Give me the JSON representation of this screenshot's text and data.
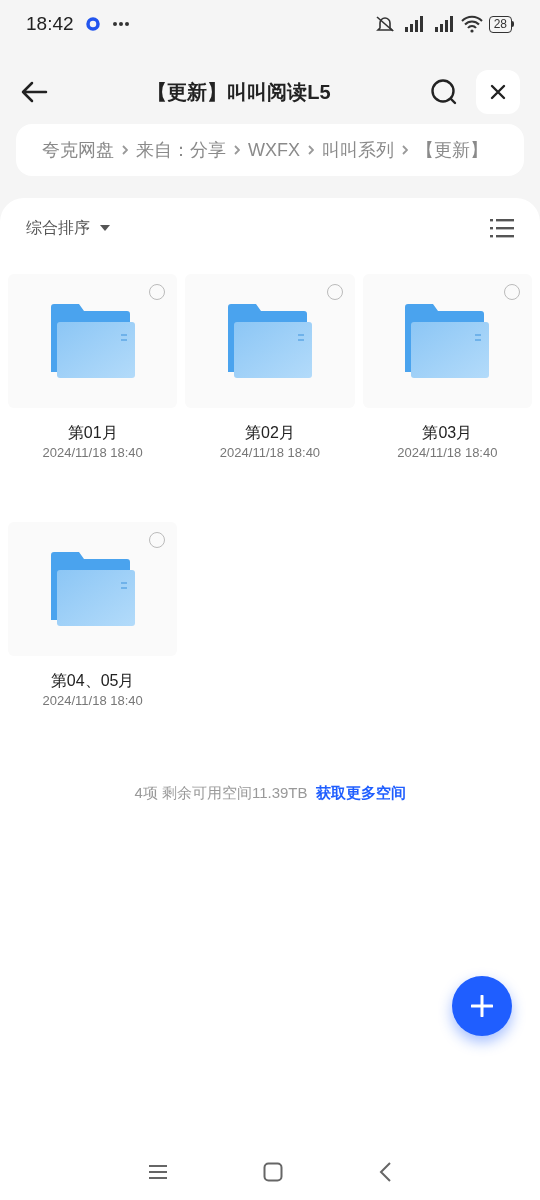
{
  "status_bar": {
    "time": "18:42",
    "battery": "28"
  },
  "header": {
    "title": "【更新】叫叫阅读L5"
  },
  "breadcrumb": [
    "夸克网盘",
    "来自：分享",
    "WXFX",
    "叫叫系列",
    "【更新】"
  ],
  "toolbar": {
    "sort": "综合排序"
  },
  "files": [
    {
      "name": "第01月",
      "date": "2024/11/18 18:40",
      "selected": false
    },
    {
      "name": "第02月",
      "date": "2024/11/18 18:40",
      "selected": false
    },
    {
      "name": "第03月",
      "date": "2024/11/18 18:40",
      "selected": false
    },
    {
      "name": "第04、05月",
      "date": "2024/11/18 18:40",
      "selected": false
    }
  ],
  "footer": {
    "summary": "4项 剩余可用空间11.39TB",
    "link": "获取更多空间"
  }
}
